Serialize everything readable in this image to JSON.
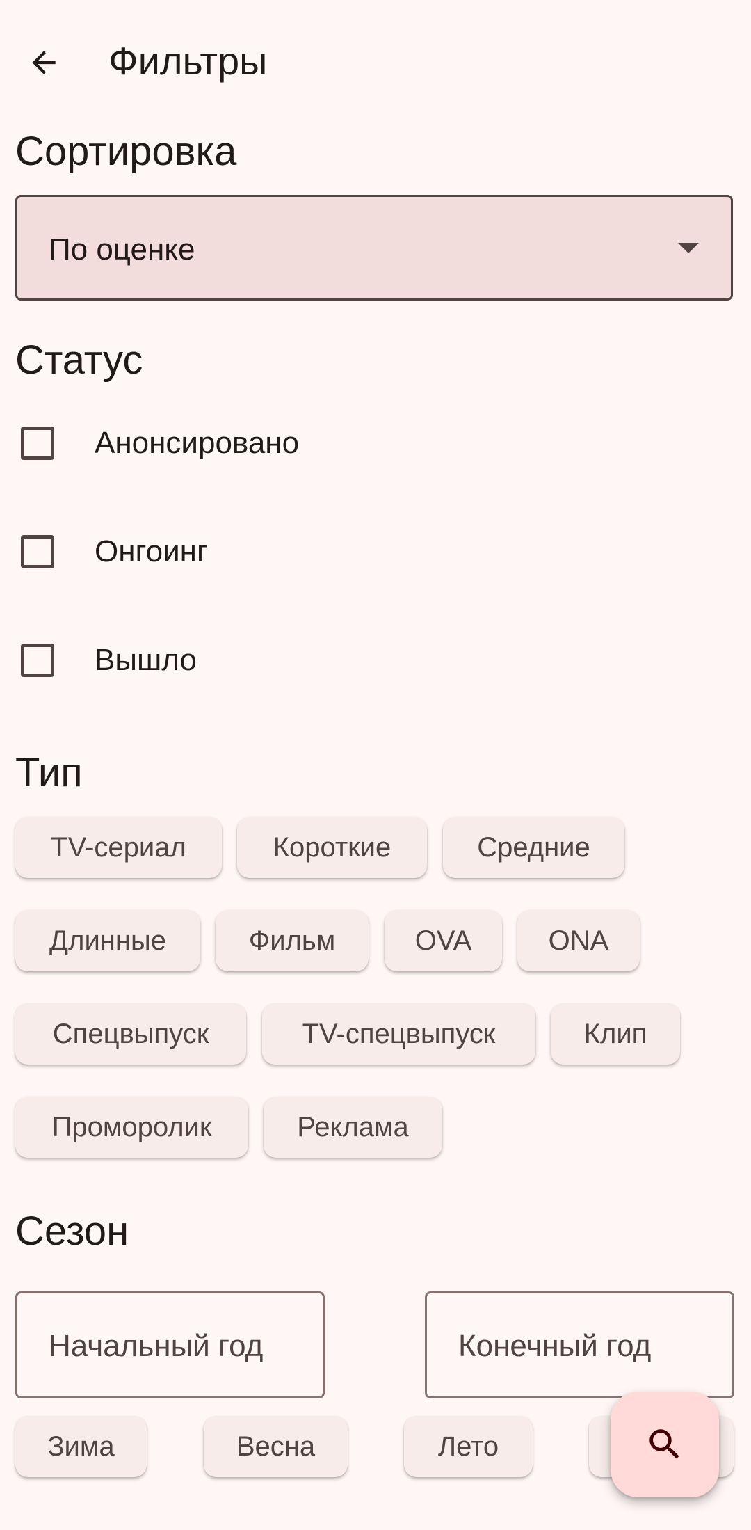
{
  "header": {
    "title": "Фильтры"
  },
  "sort": {
    "title": "Сортировка",
    "selected": "По оценке"
  },
  "status": {
    "title": "Статус",
    "options": [
      {
        "label": "Анонсировано",
        "checked": false
      },
      {
        "label": "Онгоинг",
        "checked": false
      },
      {
        "label": "Вышло",
        "checked": false
      }
    ]
  },
  "type": {
    "title": "Тип",
    "chips": [
      "TV-сериал",
      "Короткие",
      "Средние",
      "Длинные",
      "Фильм",
      "OVA",
      "ONA",
      "Спецвыпуск",
      "TV-спецвыпуск",
      "Клип",
      "Проморолик",
      "Реклама"
    ]
  },
  "season": {
    "title": "Сезон",
    "start_year_placeholder": "Начальный год",
    "end_year_placeholder": "Конечный год",
    "chips": [
      "Зима",
      "Весна",
      "Лето",
      ""
    ]
  },
  "fab": {
    "icon": "search-icon"
  },
  "colors": {
    "background": "#fff7f5",
    "dropdown_fill": "#f2dcdc",
    "chip_fill": "#f7ecea",
    "fab_fill": "#ffdad8",
    "on_surface": "#231918",
    "on_surface_variant": "#524343"
  }
}
